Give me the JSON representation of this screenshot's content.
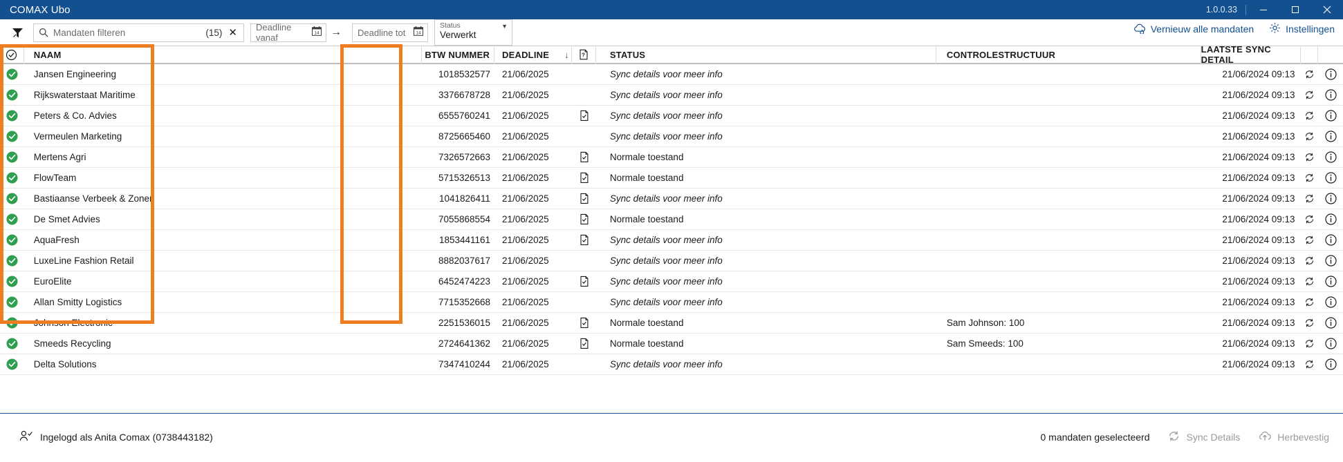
{
  "window": {
    "title": "COMAX Ubo",
    "version": "1.0.0.33",
    "minimize_label": "minimize-icon",
    "maximize_label": "maximize-icon",
    "close_label": "close-icon"
  },
  "toolbar": {
    "filter_icon": "funnel-icon",
    "search": {
      "placeholder": "Mandaten filteren",
      "count": "(15)",
      "clear": "✕"
    },
    "deadline_from": {
      "placeholder": "Deadline vanaf",
      "calendar_icon": "calendar-icon"
    },
    "range_arrow": "→",
    "deadline_to": {
      "placeholder": "Deadline tot",
      "calendar_icon": "calendar-icon"
    },
    "status_filter": {
      "label": "Status",
      "value": "Verwerkt"
    },
    "refresh_all": "Vernieuw alle mandaten",
    "settings": "Instellingen"
  },
  "grid": {
    "headers": {
      "select_all": "",
      "name": "NAAM",
      "blank": "",
      "btw": "BTW NUMMER",
      "deadline": "DEADLINE",
      "sort_arrow": "↓",
      "doc": "?",
      "status": "STATUS",
      "control": "CONTROLESTRUCTUUR",
      "last_sync": "LAATSTE SYNC DETAIL",
      "col_sync_action": "",
      "col_info_action": ""
    },
    "rows": [
      {
        "name": "Jansen Engineering",
        "btw": "1018532577",
        "deadline": "21/06/2025",
        "has_doc": false,
        "status": "Sync details voor meer info",
        "status_italic": true,
        "control": "",
        "sync": "21/06/2024 09:13"
      },
      {
        "name": "Rijkswaterstaat Maritime",
        "btw": "3376678728",
        "deadline": "21/06/2025",
        "has_doc": false,
        "status": "Sync details voor meer info",
        "status_italic": true,
        "control": "",
        "sync": "21/06/2024 09:13"
      },
      {
        "name": "Peters & Co. Advies",
        "btw": "6555760241",
        "deadline": "21/06/2025",
        "has_doc": true,
        "status": "Sync details voor meer info",
        "status_italic": true,
        "control": "",
        "sync": "21/06/2024 09:13"
      },
      {
        "name": "Vermeulen Marketing",
        "btw": "8725665460",
        "deadline": "21/06/2025",
        "has_doc": false,
        "status": "Sync details voor meer info",
        "status_italic": true,
        "control": "",
        "sync": "21/06/2024 09:13"
      },
      {
        "name": "Mertens Agri",
        "btw": "7326572663",
        "deadline": "21/06/2025",
        "has_doc": true,
        "status": "Normale toestand",
        "status_italic": false,
        "control": "",
        "sync": "21/06/2024 09:13"
      },
      {
        "name": "FlowTeam",
        "btw": "5715326513",
        "deadline": "21/06/2025",
        "has_doc": true,
        "status": "Normale toestand",
        "status_italic": false,
        "control": "",
        "sync": "21/06/2024 09:13"
      },
      {
        "name": "Bastiaanse Verbeek & Zonen",
        "btw": "1041826411",
        "deadline": "21/06/2025",
        "has_doc": true,
        "status": "Sync details voor meer info",
        "status_italic": true,
        "control": "",
        "sync": "21/06/2024 09:13"
      },
      {
        "name": "De Smet Advies",
        "btw": "7055868554",
        "deadline": "21/06/2025",
        "has_doc": true,
        "status": "Normale toestand",
        "status_italic": false,
        "control": "",
        "sync": "21/06/2024 09:13"
      },
      {
        "name": "AquaFresh",
        "btw": "1853441161",
        "deadline": "21/06/2025",
        "has_doc": true,
        "status": "Sync details voor meer info",
        "status_italic": true,
        "control": "",
        "sync": "21/06/2024 09:13"
      },
      {
        "name": "LuxeLine Fashion Retail",
        "btw": "8882037617",
        "deadline": "21/06/2025",
        "has_doc": false,
        "status": "Sync details voor meer info",
        "status_italic": true,
        "control": "",
        "sync": "21/06/2024 09:13"
      },
      {
        "name": "EuroElite",
        "btw": "6452474223",
        "deadline": "21/06/2025",
        "has_doc": true,
        "status": "Sync details voor meer info",
        "status_italic": true,
        "control": "",
        "sync": "21/06/2024 09:13"
      },
      {
        "name": "Allan Smitty Logistics",
        "btw": "7715352668",
        "deadline": "21/06/2025",
        "has_doc": false,
        "status": "Sync details voor meer info",
        "status_italic": true,
        "control": "",
        "sync": "21/06/2024 09:13"
      },
      {
        "name": "Johnson Electronic",
        "btw": "2251536015",
        "deadline": "21/06/2025",
        "has_doc": true,
        "status": "Normale toestand",
        "status_italic": false,
        "control": "Sam Johnson: 100",
        "sync": "21/06/2024 09:13"
      },
      {
        "name": "Smeeds Recycling",
        "btw": "2724641362",
        "deadline": "21/06/2025",
        "has_doc": true,
        "status": "Normale toestand",
        "status_italic": false,
        "control": "Sam Smeeds: 100",
        "sync": "21/06/2024 09:13"
      },
      {
        "name": "Delta Solutions",
        "btw": "7347410244",
        "deadline": "21/06/2025",
        "has_doc": false,
        "status": "Sync details voor meer info",
        "status_italic": true,
        "control": "",
        "sync": "21/06/2024 09:13"
      }
    ]
  },
  "statusbar": {
    "user_icon": "user-check-icon",
    "logged_in": "Ingelogd als Anita Comax (0738443182)",
    "selection": "0 mandaten geselecteerd",
    "sync_details": "Sync Details",
    "reconfirm": "Herbevestig"
  },
  "colors": {
    "titlebar": "#12508f",
    "accent_link": "#12508f",
    "check_green": "#2e9e4f",
    "annotation_orange": "#ef7d22",
    "disabled_text": "#9a9a9a"
  },
  "annotations": [
    {
      "name": "naam-column-highlight",
      "color": "#ef7d22"
    },
    {
      "name": "deadline-column-highlight",
      "color": "#ef7d22"
    }
  ]
}
